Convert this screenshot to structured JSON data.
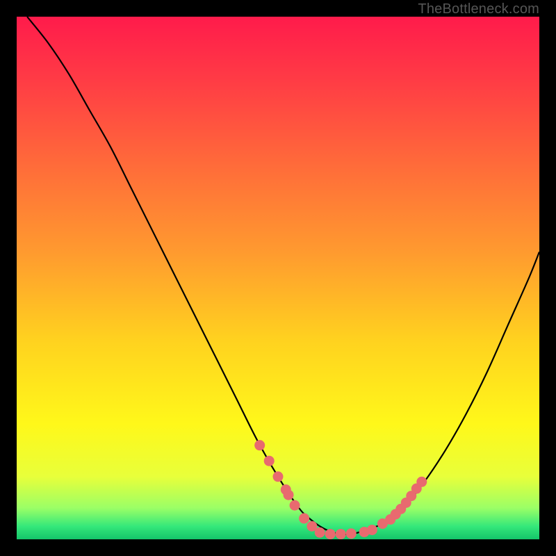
{
  "watermark": "TheBottleneck.com",
  "chart_data": {
    "type": "line",
    "title": "",
    "xlabel": "",
    "ylabel": "",
    "xlim": [
      0,
      100
    ],
    "ylim": [
      0,
      100
    ],
    "series": [
      {
        "name": "curve",
        "x": [
          2,
          6,
          10,
          14,
          18,
          22,
          26,
          30,
          34,
          38,
          42,
          46,
          50,
          54,
          56,
          58,
          60,
          62,
          64,
          66,
          70,
          74,
          78,
          82,
          86,
          90,
          94,
          98,
          100
        ],
        "y": [
          100,
          95,
          89,
          82,
          75,
          67,
          59,
          51,
          43,
          35,
          27,
          19,
          12,
          6,
          4,
          2.5,
          1.5,
          1,
          1,
          1.5,
          3,
          6,
          11,
          17,
          24,
          32,
          41,
          50,
          55
        ]
      },
      {
        "name": "left-dots",
        "x": [
          46.5,
          48.3,
          50.0,
          51.5,
          52.0,
          53.2,
          55.0,
          56.5
        ],
        "y": [
          18.0,
          15.0,
          12.0,
          9.5,
          8.5,
          6.5,
          4.0,
          2.5
        ]
      },
      {
        "name": "bottom-dots",
        "x": [
          58.0,
          60.0,
          62.0,
          64.0,
          66.5,
          68.0
        ],
        "y": [
          1.3,
          1.0,
          1.0,
          1.1,
          1.4,
          1.8
        ]
      },
      {
        "name": "right-dots",
        "x": [
          70.0,
          71.5,
          72.5,
          73.5,
          74.5,
          75.5,
          76.5,
          77.5
        ],
        "y": [
          3.0,
          3.8,
          4.8,
          5.8,
          7.0,
          8.3,
          9.7,
          11.0
        ]
      }
    ],
    "gradient_stops": [
      {
        "pos": 0.0,
        "color": "#ff1b4b"
      },
      {
        "pos": 0.12,
        "color": "#ff3b45"
      },
      {
        "pos": 0.28,
        "color": "#ff6a3a"
      },
      {
        "pos": 0.45,
        "color": "#ff9a2f"
      },
      {
        "pos": 0.62,
        "color": "#ffd21f"
      },
      {
        "pos": 0.78,
        "color": "#fff81a"
      },
      {
        "pos": 0.88,
        "color": "#e8ff3a"
      },
      {
        "pos": 0.94,
        "color": "#9bff66"
      },
      {
        "pos": 0.975,
        "color": "#35e87a"
      },
      {
        "pos": 1.0,
        "color": "#14c56a"
      }
    ],
    "dot_color": "#e86a6f",
    "curve_color": "#000000"
  }
}
